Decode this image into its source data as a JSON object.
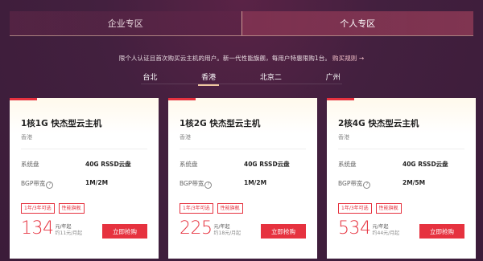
{
  "tabs": [
    {
      "label": "企业专区",
      "active": false
    },
    {
      "label": "个人专区",
      "active": true
    }
  ],
  "notice": {
    "text": "限个人认证且首次购买云主机的用户。新一代性能旗舰，每用户特惠限购1台。",
    "rule_link": "购买规则 →"
  },
  "regions": [
    {
      "label": "台北",
      "active": false
    },
    {
      "label": "香港",
      "active": true
    },
    {
      "label": "北京二",
      "active": false
    },
    {
      "label": "广州",
      "active": false
    }
  ],
  "cards": [
    {
      "title": "1核1G 快杰型云主机",
      "location": "香港",
      "disk_label": "系统盘",
      "disk_value": "40G RSSD云盘",
      "bw_label": "BGP带宽",
      "bw_value": "1M/2M",
      "tags": [
        "1年/3年可选",
        "性能旗舰"
      ],
      "price": "134",
      "price_unit": "元/年起",
      "price_sub": "约11元/月起",
      "buy_label": "立即抢购"
    },
    {
      "title": "1核2G 快杰型云主机",
      "location": "香港",
      "disk_label": "系统盘",
      "disk_value": "40G RSSD云盘",
      "bw_label": "BGP带宽",
      "bw_value": "1M/2M",
      "tags": [
        "1年/3年可选",
        "性能旗舰"
      ],
      "price": "225",
      "price_unit": "元/年起",
      "price_sub": "约18元/月起",
      "buy_label": "立即抢购"
    },
    {
      "title": "2核4G 快杰型云主机",
      "location": "香港",
      "disk_label": "系统盘",
      "disk_value": "40G RSSD云盘",
      "bw_label": "BGP带宽",
      "bw_value": "2M/5M",
      "tags": [
        "1年/3年可选",
        "性能旗舰"
      ],
      "price": "534",
      "price_unit": "元/年起",
      "price_sub": "约44元/月起",
      "buy_label": "立即抢购"
    }
  ],
  "colors": {
    "accent": "#e6323f",
    "background": "#43203f",
    "region_underline": "#f0c7a0"
  },
  "icons": {
    "help": "question-circle-icon"
  }
}
